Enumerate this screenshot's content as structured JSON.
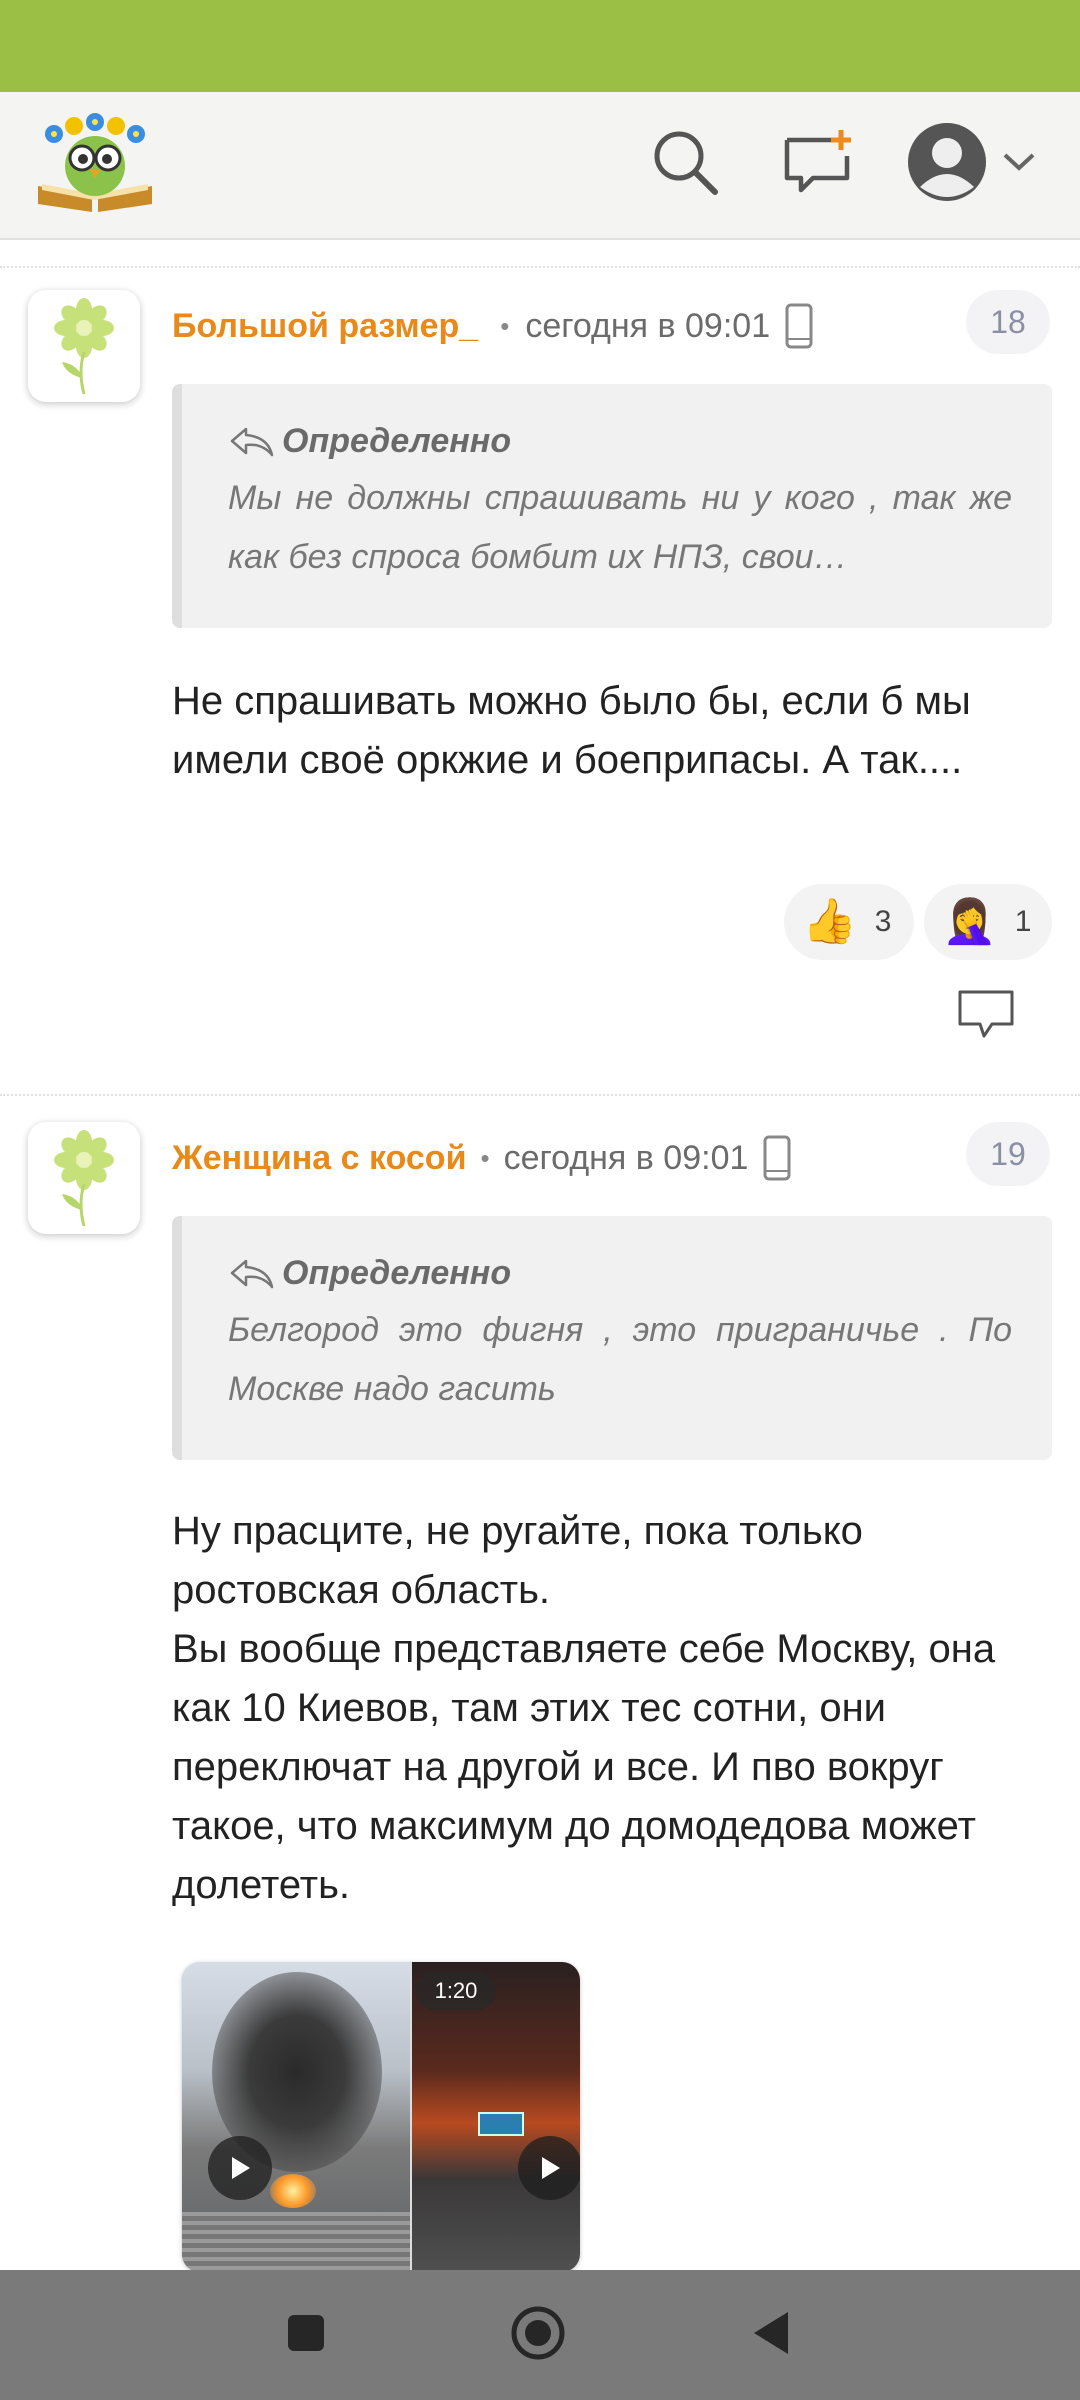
{
  "app": {
    "logo_icon": "owl-book-logo",
    "header_icons": [
      "search-icon",
      "new-message-icon",
      "user-avatar-icon",
      "chevron-down-icon"
    ],
    "accent_color": "#9bbe45"
  },
  "comments": [
    {
      "author": "Большой размер_",
      "time": "сегодня в 09:01",
      "number": "18",
      "quote": {
        "author": "Определенно",
        "text": "Мы не должны спрашивать ни у кого , так же как без спроса бомбит их НПЗ, свои…"
      },
      "body": "Не спрашивать можно было бы, если б мы имели своё оркжие и боеприпасы. А так....",
      "reactions": [
        {
          "emoji": "👍",
          "count": "3",
          "name": "thumbs-up"
        },
        {
          "emoji": "🤦‍♀️",
          "count": "1",
          "name": "facepalm"
        }
      ]
    },
    {
      "author": "Женщина с косой",
      "time": "сегодня в 09:01",
      "number": "19",
      "quote": {
        "author": "Определенно",
        "text": "Белгород это фигня , это приграничье . По Москве надо гасить"
      },
      "body_lines": [
        "Ну прасците, не ругайте, пока только ростовская область.",
        "Вы вообще представляете себе Москву, она как 10 Киевов, там этих тес сотни, они переключат на другой и все. И пво вокруг такое, что максимум до домодедова может долететь."
      ],
      "video": {
        "duration": "1:20"
      }
    }
  ],
  "navigation": {
    "buttons": [
      "recents-button",
      "home-button",
      "back-button"
    ]
  }
}
